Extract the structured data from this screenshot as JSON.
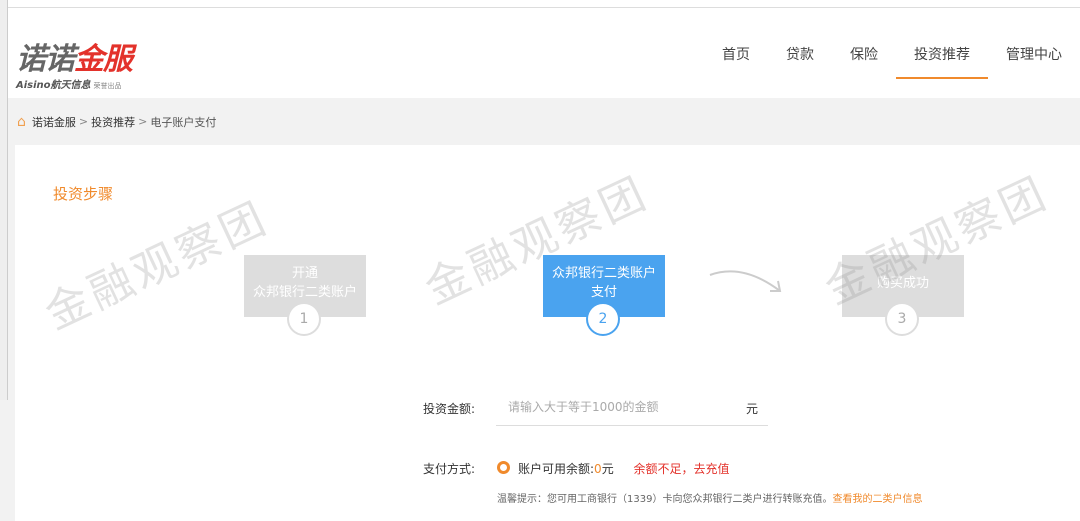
{
  "header": {
    "logo_main_gray": "诺诺",
    "logo_main_red": "金服",
    "logo_sub": "Aisino航天信息",
    "logo_tag": "荣誉出品",
    "nav": [
      {
        "label": "首页"
      },
      {
        "label": "贷款"
      },
      {
        "label": "保险"
      },
      {
        "label": "投资推荐",
        "active": true
      },
      {
        "label": "管理中心"
      }
    ]
  },
  "breadcrumb": {
    "items": [
      "诺诺金服",
      "投资推荐",
      "电子账户支付"
    ],
    "separator": ">"
  },
  "steps": {
    "title": "投资步骤",
    "items": [
      {
        "line1": "开通",
        "line2": "众邦银行二类账户",
        "number": "1"
      },
      {
        "line1": "众邦银行二类账户",
        "line2": "支付",
        "number": "2",
        "active": true
      },
      {
        "line1": "购买成功",
        "line2": "",
        "number": "3"
      }
    ]
  },
  "watermark": "金融观察团",
  "form": {
    "amount_label": "投资金额:",
    "amount_placeholder": "请输入大于等于1000的金额",
    "amount_value": "",
    "unit": "元",
    "pay_label": "支付方式:",
    "balance_label": "账户可用余额:",
    "balance_value": "0",
    "balance_unit": "元",
    "insufficient": "余额不足，去充值",
    "tip": "温馨提示：您可用工商银行（1339）卡向您众邦银行二类户进行转账充值。",
    "tip_link": "查看我的二类户信息"
  },
  "colors": {
    "accent": "#f08a2c",
    "active_step": "#4aa3ef",
    "warn": "#e3322b"
  }
}
